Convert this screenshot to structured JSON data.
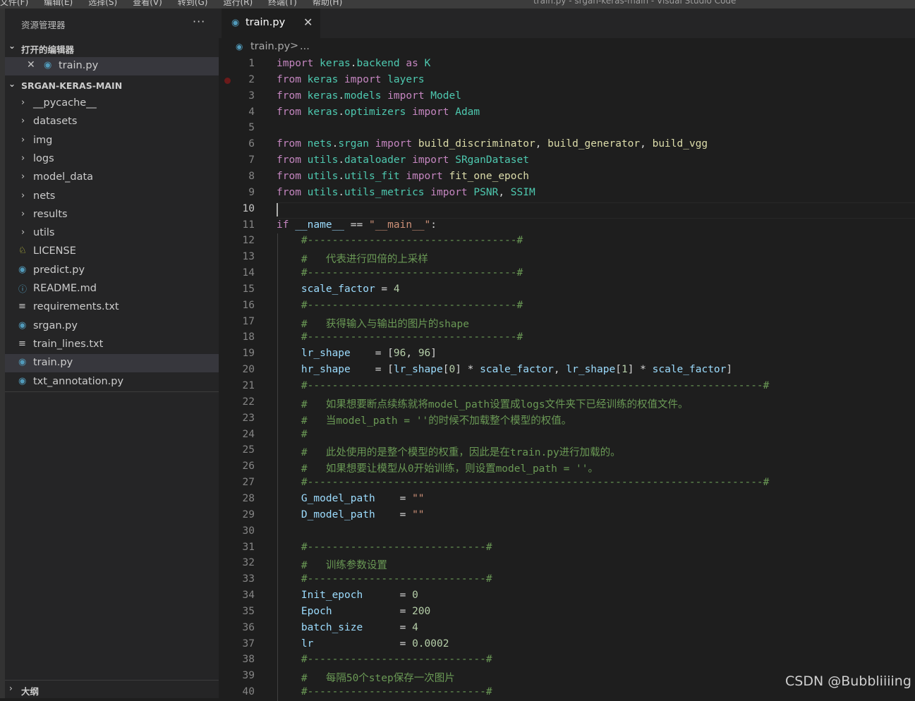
{
  "titlebar": {
    "menu": [
      "文件(F)",
      "编辑(E)",
      "选择(S)",
      "查看(V)",
      "转到(G)",
      "运行(R)",
      "终端(T)",
      "帮助(H)"
    ],
    "window_title": "train.py - srgan-keras-main - Visual Studio Code"
  },
  "sidebar": {
    "title": "资源管理器",
    "more": "···",
    "open_editors_label": "打开的编辑器",
    "open_editor_file": "train.py",
    "workspace_label": "SRGAN-KERAS-MAIN",
    "folders": [
      "__pycache__",
      "datasets",
      "img",
      "logs",
      "model_data",
      "nets",
      "results",
      "utils"
    ],
    "files": [
      {
        "name": "LICENSE",
        "icon": "license-icon"
      },
      {
        "name": "predict.py",
        "icon": "python-icon"
      },
      {
        "name": "README.md",
        "icon": "info-icon"
      },
      {
        "name": "requirements.txt",
        "icon": "text-file-icon"
      },
      {
        "name": "srgan.py",
        "icon": "python-icon"
      },
      {
        "name": "train_lines.txt",
        "icon": "text-file-icon"
      },
      {
        "name": "train.py",
        "icon": "python-icon",
        "active": true
      },
      {
        "name": "txt_annotation.py",
        "icon": "python-icon"
      }
    ],
    "outline_label": "大纲"
  },
  "editor": {
    "tab_label": "train.py",
    "breadcrumb_file": "train.py",
    "breadcrumb_sep": ">",
    "breadcrumb_more": "...",
    "current_line": 10,
    "breakpoint_line": 2,
    "lines": [
      "import keras.backend as K",
      "from keras import layers",
      "from keras.models import Model",
      "from keras.optimizers import Adam",
      "",
      "from nets.srgan import build_discriminator, build_generator, build_vgg",
      "from utils.dataloader import SRganDataset",
      "from utils.utils_fit import fit_one_epoch",
      "from utils.utils_metrics import PSNR, SSIM",
      "",
      "if __name__ == \"__main__\":",
      "    #----------------------------------#",
      "    #   代表进行四倍的上采样",
      "    #----------------------------------#",
      "    scale_factor = 4",
      "    #----------------------------------#",
      "    #   获得输入与输出的图片的shape",
      "    #----------------------------------#",
      "    lr_shape    = [96, 96]",
      "    hr_shape    = [lr_shape[0] * scale_factor, lr_shape[1] * scale_factor]",
      "    #--------------------------------------------------------------------------#",
      "    #   如果想要断点续练就将model_path设置成logs文件夹下已经训练的权值文件。",
      "    #   当model_path = ''的时候不加载整个模型的权值。",
      "    #",
      "    #   此处使用的是整个模型的权重，因此是在train.py进行加载的。",
      "    #   如果想要让模型从0开始训练，则设置model_path = ''。",
      "    #--------------------------------------------------------------------------#",
      "    G_model_path    = \"\"",
      "    D_model_path    = \"\"",
      "",
      "    #-----------------------------#",
      "    #   训练参数设置",
      "    #-----------------------------#",
      "    Init_epoch      = 0",
      "    Epoch           = 200",
      "    batch_size      = 4",
      "    lr              = 0.0002",
      "    #-----------------------------#",
      "    #   每隔50个step保存一次图片",
      "    #-----------------------------#"
    ]
  },
  "watermark": "CSDN @Bubbliiiing",
  "colors": {
    "editor_bg": "#1e1e1e",
    "sidebar_bg": "#252526",
    "keyword": "#c586c0",
    "module": "#4ec9b0",
    "function": "#dcdcaa",
    "variable": "#9cdcfe",
    "string": "#ce9178",
    "number": "#b5cea8",
    "comment": "#6a9955"
  }
}
